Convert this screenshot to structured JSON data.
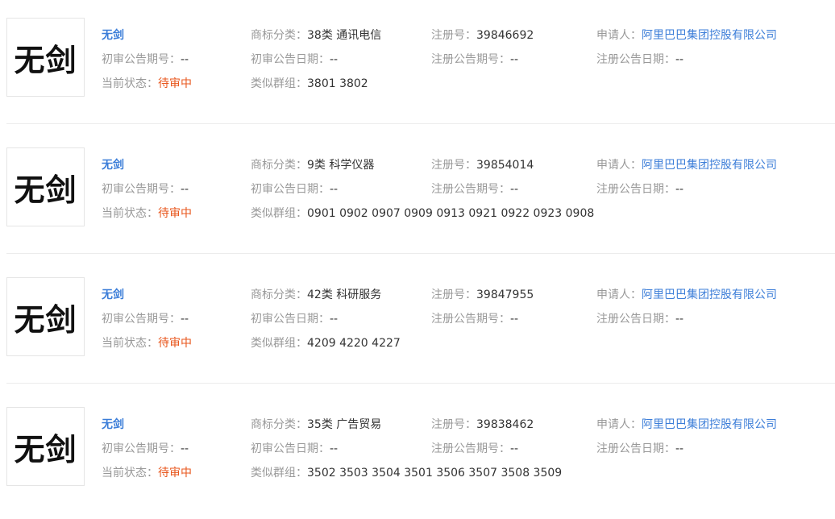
{
  "labels": {
    "initial_issue": "初审公告期号：",
    "category": "商标分类：",
    "initial_date": "初审公告日期：",
    "reg_no": "注册号：",
    "reg_issue": "注册公告期号：",
    "applicant": "申请人：",
    "reg_date": "注册公告日期：",
    "status": "当前状态：",
    "group": "类似群组："
  },
  "records": [
    {
      "mark_image_text": "无剑",
      "name": "无剑",
      "category": "38类 通讯电信",
      "reg_no": "39846692",
      "applicant": "阿里巴巴集团控股有限公司",
      "initial_issue": "--",
      "initial_date": "--",
      "reg_issue": "--",
      "reg_date": "--",
      "status": "待审中",
      "group": "3801 3802"
    },
    {
      "mark_image_text": "无剑",
      "name": "无剑",
      "category": "9类 科学仪器",
      "reg_no": "39854014",
      "applicant": "阿里巴巴集团控股有限公司",
      "initial_issue": "--",
      "initial_date": "--",
      "reg_issue": "--",
      "reg_date": "--",
      "status": "待审中",
      "group": "0901 0902 0907 0909 0913 0921 0922 0923 0908"
    },
    {
      "mark_image_text": "无剑",
      "name": "无剑",
      "category": "42类 科研服务",
      "reg_no": "39847955",
      "applicant": "阿里巴巴集团控股有限公司",
      "initial_issue": "--",
      "initial_date": "--",
      "reg_issue": "--",
      "reg_date": "--",
      "status": "待审中",
      "group": "4209 4220 4227"
    },
    {
      "mark_image_text": "无剑",
      "name": "无剑",
      "category": "35类 广告贸易",
      "reg_no": "39838462",
      "applicant": "阿里巴巴集团控股有限公司",
      "initial_issue": "--",
      "initial_date": "--",
      "reg_issue": "--",
      "reg_date": "--",
      "status": "待审中",
      "group": "3502 3503 3504 3501 3506 3507 3508 3509"
    }
  ]
}
